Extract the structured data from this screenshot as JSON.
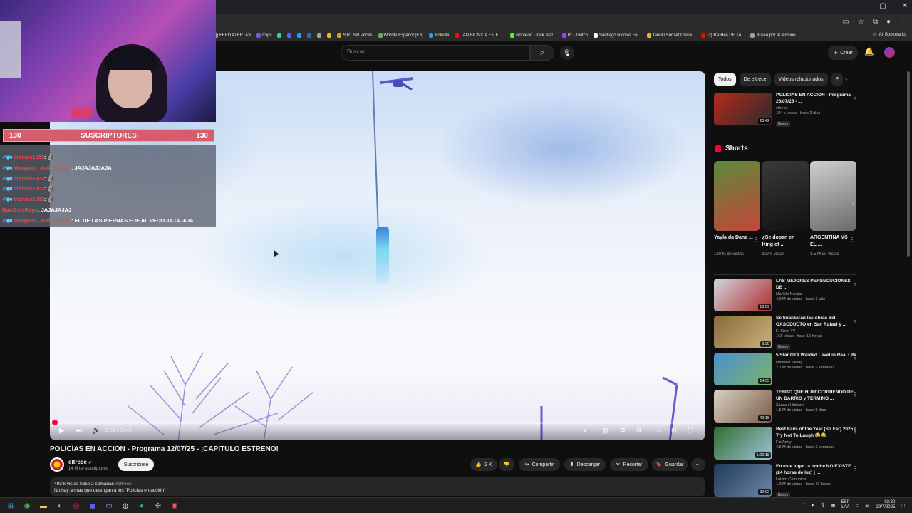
{
  "window": {
    "minimize": "–",
    "maximize": "▢",
    "close": "✕"
  },
  "bookmarks": [
    {
      "label": "FEED ALERTAS",
      "color": "#9aa0a6"
    },
    {
      "label": "Clips",
      "color": "#6b5ce7"
    },
    {
      "label": "",
      "color": "#3ecf8e"
    },
    {
      "label": "",
      "color": "#5865f2"
    },
    {
      "label": "",
      "color": "#1da1f2"
    },
    {
      "label": "",
      "color": "#2b6cb0"
    },
    {
      "label": "",
      "color": "#a0a0a0"
    },
    {
      "label": "",
      "color": "#f0b90b"
    },
    {
      "label": "STC Set Prices",
      "color": "#e0a000"
    },
    {
      "label": "Wordle Español (ES)",
      "color": "#6aaa64"
    },
    {
      "label": "Boludle",
      "color": "#2d9cdb"
    },
    {
      "label": "TAN BIONICA EN EL...",
      "color": "#ff0000"
    },
    {
      "label": "sionaron - Kick Stat...",
      "color": "#53fc18"
    },
    {
      "label": "trr - Twitch",
      "color": "#9146ff"
    },
    {
      "label": "Santiago Nicolas Fe...",
      "color": "#ffffff"
    },
    {
      "label": "Tanuki Sunset Classi...",
      "color": "#f7b500"
    },
    {
      "label": "(2) BARRA DE TA...",
      "color": "#ff0000"
    },
    {
      "label": "Buscó por el término...",
      "color": "#9aa0a6"
    }
  ],
  "all_bookmarks": "All Bookmarks",
  "youtube": {
    "search_placeholder": "Buscar",
    "create_label": "Crear"
  },
  "player": {
    "time": "0:01 / 28:41",
    "progress": 0.001
  },
  "video": {
    "title": "POLICÍAS EN ACCIÓN - Programa 12/07/25 - ¡CAPÍTULO ESTRENO!",
    "channel": "eltrece",
    "subscribers": "14 M de suscriptores",
    "subscribe_label": "Suscribirse",
    "likes": "2 K",
    "share_label": "Compartir",
    "download_label": "Descargar",
    "clip_label": "Recortar",
    "save_label": "Guardar",
    "desc_stats": "493 k vistas  hace 2 semanas",
    "desc_tag": "#eltrece",
    "desc_text": "No hay armas que detengan a los \"Policías en acción\""
  },
  "chips": [
    "Todos",
    "De eltrece",
    "Videos relacionados",
    "P"
  ],
  "recs_top": [
    {
      "title": "POLICÍAS EN ACCIÓN - Programa 26/07/25 - ...",
      "channel": "eltrece",
      "meta": "184 k vistas · hace 2 días",
      "badge": "Nuevo",
      "duration": "28:42",
      "c1": "#b52a1e",
      "c2": "#2a2a2a"
    }
  ],
  "shorts": {
    "heading": "Shorts",
    "items": [
      {
        "title": "Yayla da Dana ...",
        "views": "120 M de vistas",
        "c1": "#5d8a3a",
        "c2": "#c4463a"
      },
      {
        "title": "¿Se dopan en King of ...",
        "views": "307 k vistas",
        "c1": "#3a3a3a",
        "c2": "#111111"
      },
      {
        "title": "ARGENTINA VS EL ...",
        "views": "1.5 M de vistas",
        "c1": "#cfcfcf",
        "c2": "#6a6a6a"
      }
    ]
  },
  "recs": [
    {
      "title": "LAS MEJORES PERSECUCIONES DE ...",
      "channel": "Markito Navaja",
      "meta": "4.9 M de vistas · hace 1 año",
      "badge": "",
      "duration": "18:09",
      "c1": "#cfd8e0",
      "c2": "#b02a2a"
    },
    {
      "title": "Se finalizarán las obras del GASODUCTO en San Rafael y ...",
      "channel": "El Siete TV",
      "meta": "161 vistas · hace 16 horas",
      "badge": "Nuevo",
      "duration": "6:30",
      "c1": "#8a6b3a",
      "c2": "#c9b27a"
    },
    {
      "title": "5 Star GTA Wanted Level in Real Life",
      "channel": "Midwest Safety",
      "meta": "2.1 M de vistas · hace 2 semanas",
      "badge": "",
      "duration": "14:55",
      "c1": "#4a8fd1",
      "c2": "#7bb36a"
    },
    {
      "title": "TENGO QUE HUIR CORRIENDO DE UN BARRIO y TERMINO ...",
      "channel": "Zazza el Italiano",
      "meta": "1.5 M de vistas · hace 8 días",
      "badge": "",
      "duration": "40:18",
      "c1": "#d9d2c4",
      "c2": "#7a5b46"
    },
    {
      "title": "Best Fails of the Year (So Far) 2025 | Try Not To Laugh 😂😂",
      "channel": "FailArmy",
      "meta": "4.5 M de vistas · hace 3 semanas",
      "badge": "",
      "duration": "1:20:18",
      "c1": "#2f6e2f",
      "c2": "#9fc2d8"
    },
    {
      "title": "En este lugar la noche NO EXISTE (24 horas de luz) | ...",
      "channel": "Luisito Comunica",
      "meta": "1.2 M de vistas · hace 10 horas",
      "badge": "Nuevo",
      "duration": "32:02",
      "c1": "#1e3a5a",
      "c2": "#6d86a8"
    }
  ],
  "stream": {
    "sub_count_left": "130",
    "sub_label": "SUSCRIPTORES",
    "sub_count_right": "130",
    "chat": [
      {
        "badges": "✓◆■",
        "user": "thomas1603",
        "text": ": 🗿"
      },
      {
        "badges": "✓◆■",
        "user": "Manguita_And_Dreads",
        "text": ": JAJAJAJJAJA"
      },
      {
        "badges": "✓◆■",
        "user": "thomas1603",
        "text": ": 🗿"
      },
      {
        "badges": "✓◆■",
        "user": "thomas1603",
        "text": ": 🗿"
      },
      {
        "badges": "✓◆■",
        "user": "thomas1603",
        "text": ": 🗿"
      },
      {
        "badges": "",
        "user": "Baut1staRage",
        "text": ": JAJAJAJAJ"
      },
      {
        "badges": "✓◆■",
        "user": "Manguita_And_Dreads",
        "text": ": EL DE LAS PIERNAS FUE AL PEDO JAJAJAJA"
      }
    ]
  },
  "taskbar": {
    "lang_top": "ESP",
    "lang_bottom": "LAA",
    "time": "02:30",
    "date": "29/7/2025"
  }
}
